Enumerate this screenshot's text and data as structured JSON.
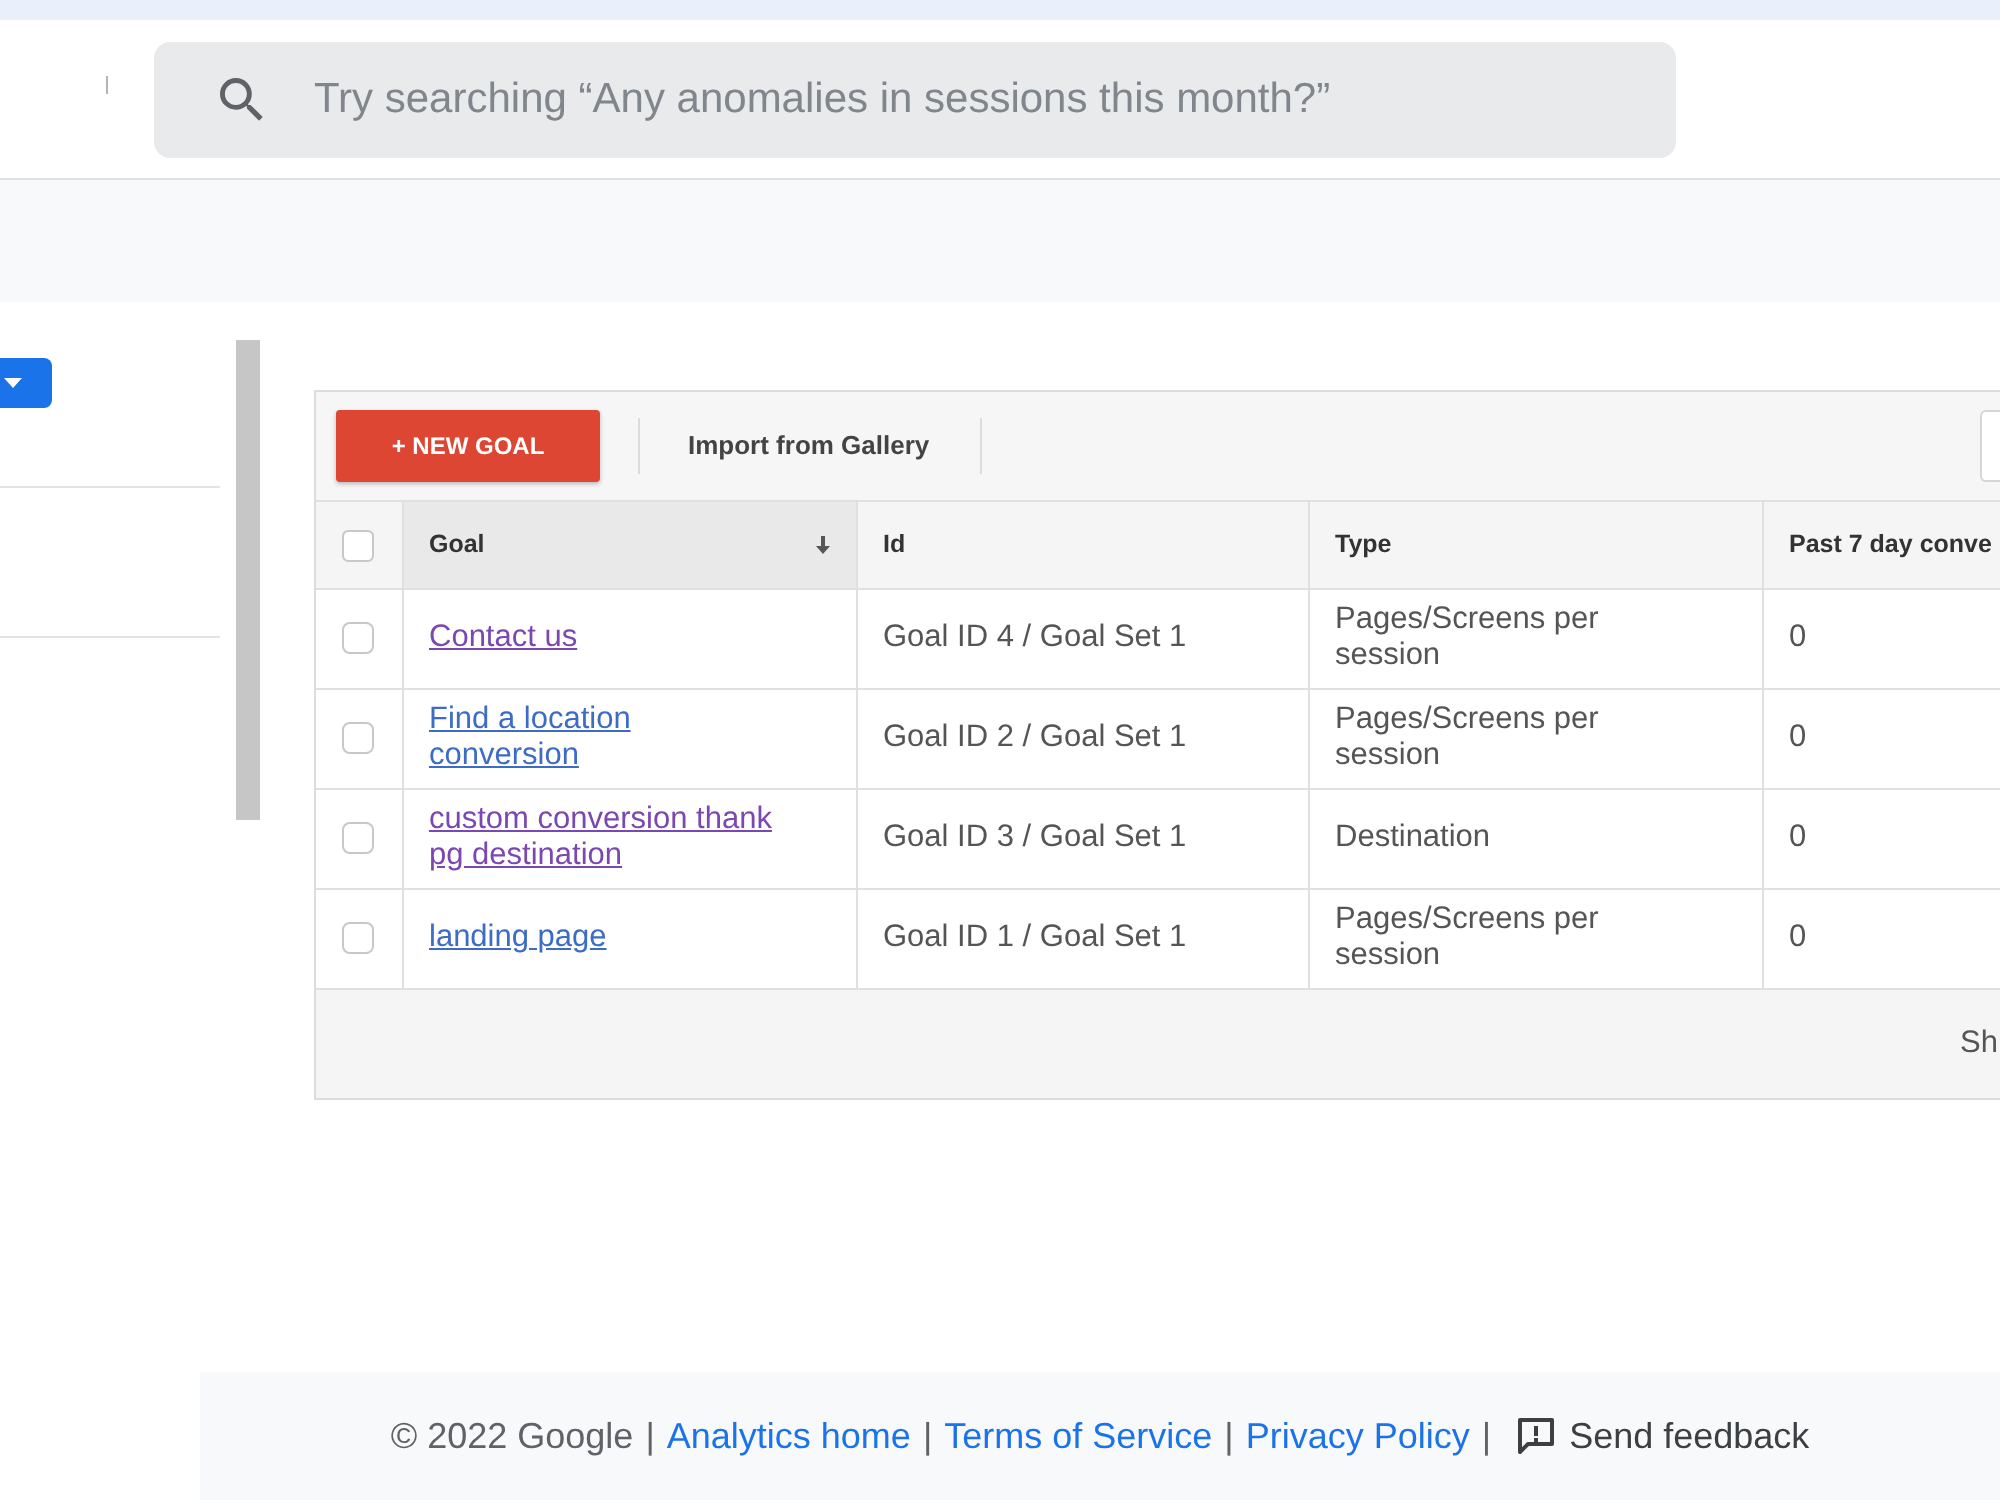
{
  "search": {
    "placeholder": "Try searching “Any anomalies in sessions this month?”"
  },
  "toolbar": {
    "new_goal_button": "+ NEW GOAL",
    "import_button": "Import from Gallery"
  },
  "table": {
    "select_all": {
      "checked": false
    },
    "columns": [
      {
        "label": "Goal",
        "sorted": true
      },
      {
        "label": "Id",
        "sorted": false
      },
      {
        "label": "Type",
        "sorted": false
      },
      {
        "label": "Past 7 day conve",
        "sorted": false
      }
    ],
    "rows": [
      {
        "checked": false,
        "visited": true,
        "cells": [
          "Contact us",
          "Goal ID 4 / Goal Set 1",
          "Pages/Screens per session",
          "0"
        ]
      },
      {
        "checked": false,
        "visited": false,
        "cells": [
          "Find a location conversion",
          "Goal ID 2 / Goal Set 1",
          "Pages/Screens per session",
          "0"
        ]
      },
      {
        "checked": false,
        "visited": true,
        "cells": [
          "custom conversion thank pg destination",
          "Goal ID 3 / Goal Set 1",
          "Destination",
          "0"
        ]
      },
      {
        "checked": false,
        "visited": false,
        "cells": [
          "landing page",
          "Goal ID 1 / Goal Set 1",
          "Pages/Screens per session",
          "0"
        ]
      }
    ],
    "footer": "Sh"
  },
  "footer": {
    "items": [
      {
        "kind": "text",
        "text": "© 2022 Google"
      },
      {
        "kind": "separator",
        "text": "|"
      },
      {
        "kind": "link",
        "text": "Analytics home"
      },
      {
        "kind": "separator",
        "text": "|"
      },
      {
        "kind": "link",
        "text": "Terms of Service"
      },
      {
        "kind": "separator",
        "text": "|"
      },
      {
        "kind": "link",
        "text": "Privacy Policy"
      },
      {
        "kind": "separator",
        "text": "|"
      },
      {
        "kind": "feedback",
        "text": "Send feedback"
      }
    ]
  }
}
